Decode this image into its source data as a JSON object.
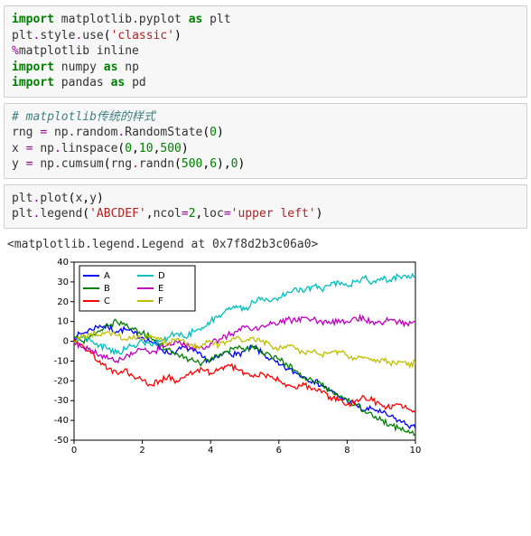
{
  "cells": {
    "c1": {
      "l1_import": "import",
      "l1_mpl": "matplotlib.pyplot",
      "l1_as": "as",
      "l1_plt": "plt",
      "l2_a": "plt",
      "l2_b": "style",
      "l2_c": "use",
      "l2_str": "'classic'",
      "l3_magic": "%",
      "l3_rest": "matplotlib inline",
      "l4_import": "import",
      "l4_np": "numpy",
      "l4_as": "as",
      "l4_npa": "np",
      "l5_import": "import",
      "l5_pd": "pandas",
      "l5_as": "as",
      "l5_pda": "pd"
    },
    "c2": {
      "l1_comment": "# matplotlib传统的样式",
      "l2_rng": "rng",
      "l2_np": "np",
      "l2_rand": "random",
      "l2_rs": "RandomState",
      "l2_zero": "0",
      "l3_x": "x",
      "l3_np": "np",
      "l3_lin": "linspace",
      "l3_a": "0",
      "l3_b": "10",
      "l3_c": "500",
      "l4_y": "y",
      "l4_np": "np",
      "l4_cs": "cumsum",
      "l4_rng": "rng",
      "l4_rn": "randn",
      "l4_a": "500",
      "l4_b": "6",
      "l4_c": "0"
    },
    "c3": {
      "l1_plt": "plt",
      "l1_plot": "plot",
      "l1_x": "x",
      "l1_y": "y",
      "l2_plt": "plt",
      "l2_leg": "legend",
      "l2_str": "'ABCDEF'",
      "l2_ncol": "ncol",
      "l2_2": "2",
      "l2_loc": "loc",
      "l2_locstr": "'upper left'"
    },
    "out_repr": "<matplotlib.legend.Legend at 0x7f8d2b3c06a0>"
  },
  "chart_data": {
    "type": "line",
    "x_range": [
      0,
      10
    ],
    "y_range": [
      -50,
      40
    ],
    "x_ticks": [
      0,
      2,
      4,
      6,
      8,
      10
    ],
    "y_ticks": [
      -50,
      -40,
      -30,
      -20,
      -10,
      0,
      10,
      20,
      30,
      40
    ],
    "legend": {
      "ncol": 2,
      "loc": "upper left",
      "labels": [
        "A",
        "B",
        "C",
        "D",
        "E",
        "F"
      ]
    },
    "series": [
      {
        "name": "A",
        "color": "#0000ff",
        "values": [
          2,
          4,
          6,
          8,
          7,
          5,
          6,
          4,
          2,
          0,
          -3,
          -6,
          -5,
          -3,
          -5,
          -8,
          -10,
          -8,
          -5,
          -7,
          -5,
          -3,
          -6,
          -9,
          -12,
          -14,
          -16,
          -18,
          -20,
          -22,
          -25,
          -28,
          -30,
          -32,
          -35,
          -34,
          -36,
          -38,
          -40,
          -42,
          -44
        ]
      },
      {
        "name": "B",
        "color": "#008000",
        "values": [
          2,
          0,
          3,
          5,
          8,
          10,
          8,
          6,
          4,
          2,
          -2,
          -4,
          -6,
          -8,
          -10,
          -11,
          -9,
          -7,
          -5,
          -3,
          -5,
          -3,
          -5,
          -7,
          -9,
          -12,
          -15,
          -18,
          -20,
          -22,
          -25,
          -28,
          -30,
          -32,
          -35,
          -38,
          -40,
          -42,
          -44,
          -46,
          -47
        ]
      },
      {
        "name": "C",
        "color": "#ff0000",
        "values": [
          1,
          -2,
          -6,
          -10,
          -14,
          -16,
          -14,
          -18,
          -20,
          -22,
          -20,
          -18,
          -20,
          -18,
          -16,
          -14,
          -16,
          -14,
          -12,
          -14,
          -16,
          -18,
          -16,
          -18,
          -20,
          -22,
          -24,
          -22,
          -24,
          -26,
          -28,
          -30,
          -32,
          -30,
          -28,
          -30,
          -32,
          -34,
          -32,
          -34,
          -36
        ]
      },
      {
        "name": "D",
        "color": "#00bfbf",
        "values": [
          0,
          2,
          0,
          -2,
          -4,
          -6,
          -4,
          -2,
          0,
          -2,
          0,
          2,
          4,
          2,
          5,
          7,
          10,
          13,
          16,
          18,
          16,
          20,
          22,
          20,
          22,
          25,
          27,
          25,
          28,
          26,
          28,
          30,
          28,
          30,
          32,
          30,
          32,
          31,
          33,
          32,
          33
        ]
      },
      {
        "name": "E",
        "color": "#bf00bf",
        "values": [
          -1,
          -3,
          -5,
          -7,
          -9,
          -10,
          -8,
          -6,
          -4,
          -6,
          -4,
          -2,
          0,
          -2,
          -4,
          -3,
          -1,
          1,
          3,
          5,
          7,
          6,
          8,
          10,
          9,
          11,
          10,
          12,
          11,
          10,
          9,
          11,
          10,
          12,
          11,
          10,
          9,
          11,
          10,
          9,
          10
        ]
      },
      {
        "name": "F",
        "color": "#bfbf00",
        "values": [
          0,
          2,
          4,
          3,
          5,
          3,
          1,
          3,
          1,
          3,
          1,
          -1,
          1,
          -1,
          -3,
          -2,
          0,
          -2,
          0,
          2,
          0,
          2,
          0,
          -2,
          -4,
          -2,
          -4,
          -6,
          -5,
          -7,
          -6,
          -5,
          -7,
          -9,
          -8,
          -10,
          -9,
          -11,
          -10,
          -12,
          -11
        ]
      }
    ]
  }
}
